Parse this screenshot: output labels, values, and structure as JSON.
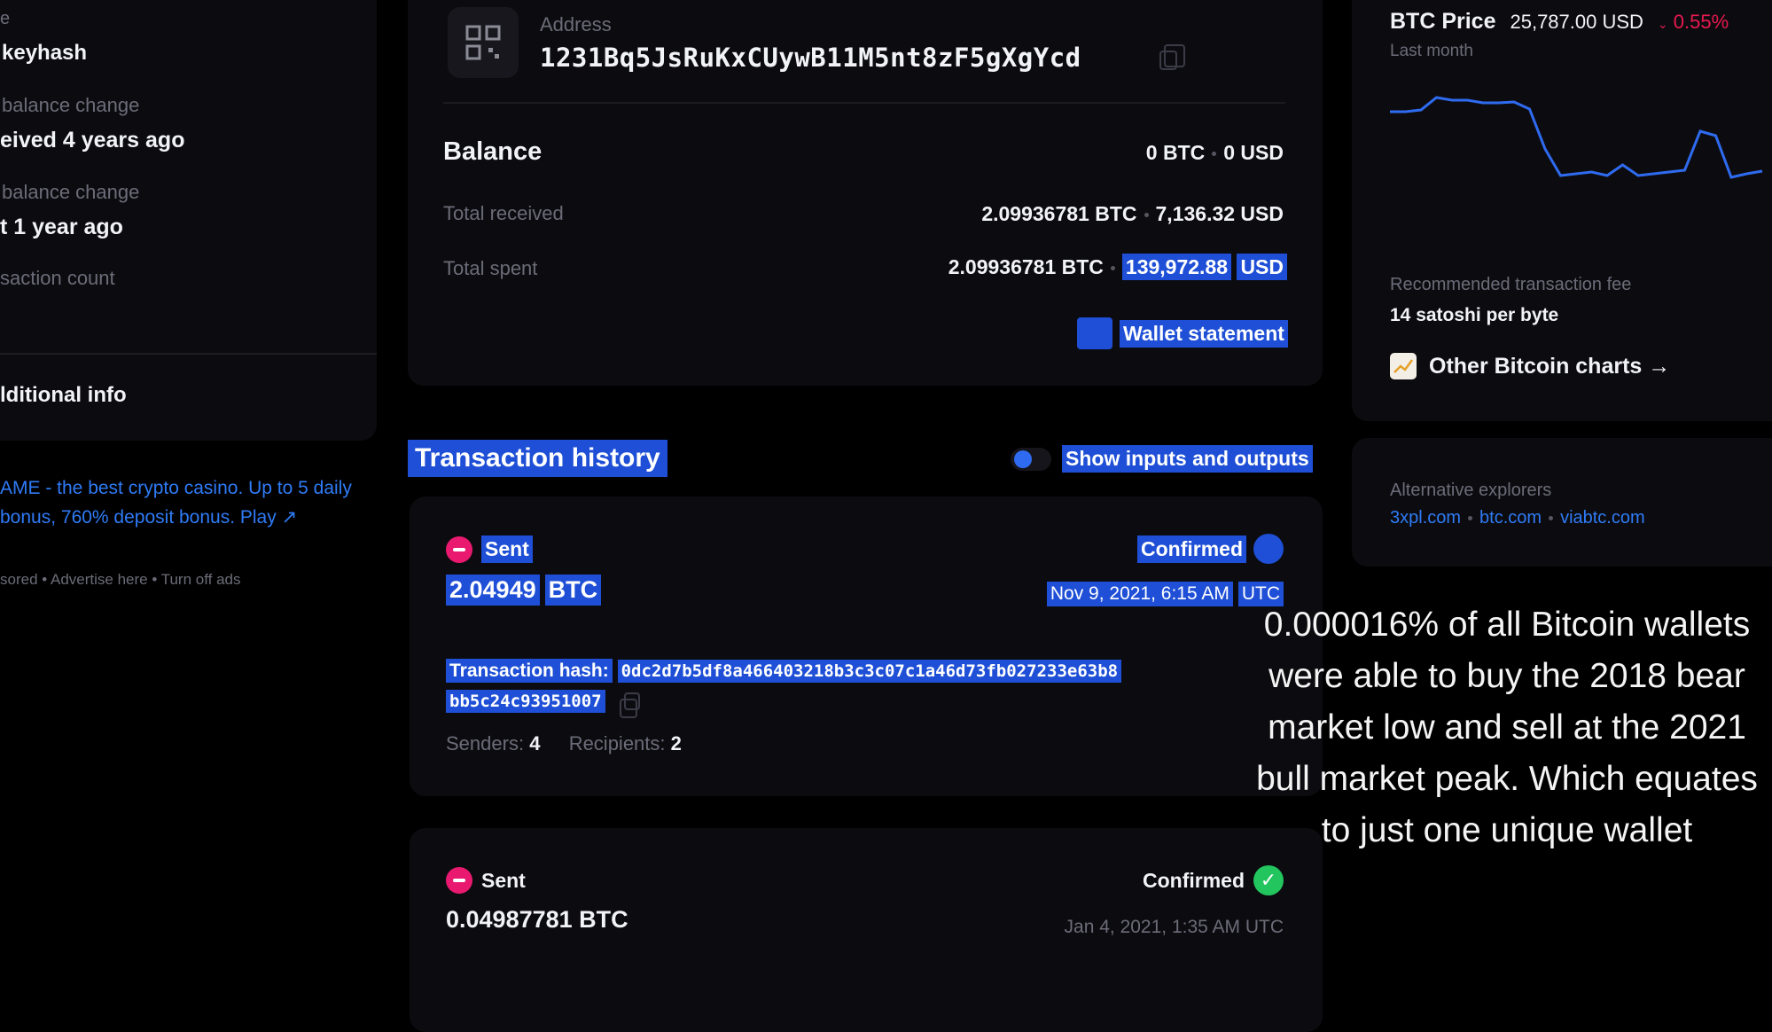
{
  "left": {
    "top_fragment": "e",
    "hash_label": "keyhash",
    "first_change_label": "balance change",
    "first_change_value": "eived 4 years ago",
    "last_change_label": "balance change",
    "last_change_value": "t 1 year ago",
    "tx_count_label": "saction count",
    "additional_info": "lditional info",
    "ad_text": "AME - the best crypto casino. Up to 5 daily bonus, 760% deposit bonus. Play",
    "ad_arrow": "↗",
    "ad_links": [
      "sored",
      "Advertise here",
      "Turn off ads"
    ]
  },
  "address": {
    "label": "Address",
    "value": "1231Bq5JsRuKxCUywB11M5nt8zF5gXgYcd"
  },
  "balance": {
    "title": "Balance",
    "btc": "0 BTC",
    "usd": "0 USD",
    "rows": [
      {
        "label": "Total received",
        "btc": "2.09936781 BTC",
        "usd": "7,136.32 USD"
      },
      {
        "label": "Total spent",
        "btc": "2.09936781 BTC",
        "usd_amount": "139,972.88",
        "usd_unit": "USD"
      }
    ],
    "wallet_statement": "Wallet statement"
  },
  "history": {
    "title": "Transaction history",
    "toggle_label": "Show inputs and outputs",
    "transactions": [
      {
        "type": "Sent",
        "amount": "2.04949",
        "unit": "BTC",
        "status": "Confirmed",
        "date": "Nov 9, 2021, 6:15 AM",
        "tz": "UTC",
        "hash_label": "Transaction hash:",
        "hash_line1": "0dc2d7b5df8a466403218b3c3c07c1a46d73fb027233e63b8",
        "hash_line2": "bb5c24c93951007",
        "senders_label": "Senders:",
        "senders": "4",
        "recipients_label": "Recipients:",
        "recipients": "2"
      },
      {
        "type": "Sent",
        "amount": "0.04987781 BTC",
        "status": "Confirmed",
        "date": "Jan 4, 2021, 1:35 AM UTC"
      }
    ]
  },
  "price": {
    "title": "BTC Price",
    "value": "25,787.00 USD",
    "change": "0.55%",
    "period": "Last month",
    "chart_points": [
      38,
      38,
      36,
      22,
      25,
      25,
      28,
      28,
      27,
      35,
      80,
      110,
      108,
      106,
      110,
      98,
      110,
      108,
      106,
      104,
      60,
      65,
      112,
      108,
      105
    ],
    "fee_label": "Recommended transaction fee",
    "fee_value": "14 satoshi per byte",
    "other_charts": "Other Bitcoin charts →"
  },
  "explorers": {
    "label": "Alternative explorers",
    "links": [
      "3xpl.com",
      "btc.com",
      "viabtc.com"
    ]
  },
  "caption": {
    "text": "0.000016% of all Bitcoin wallets were able to buy the 2018 bear market low and sell at the 2021 bull market peak. Which equates to just one unique wallet"
  },
  "colors": {
    "accent": "#1e4fd6",
    "negative": "#e8196f",
    "positive": "#22c55e",
    "link": "#2f7bf6"
  }
}
